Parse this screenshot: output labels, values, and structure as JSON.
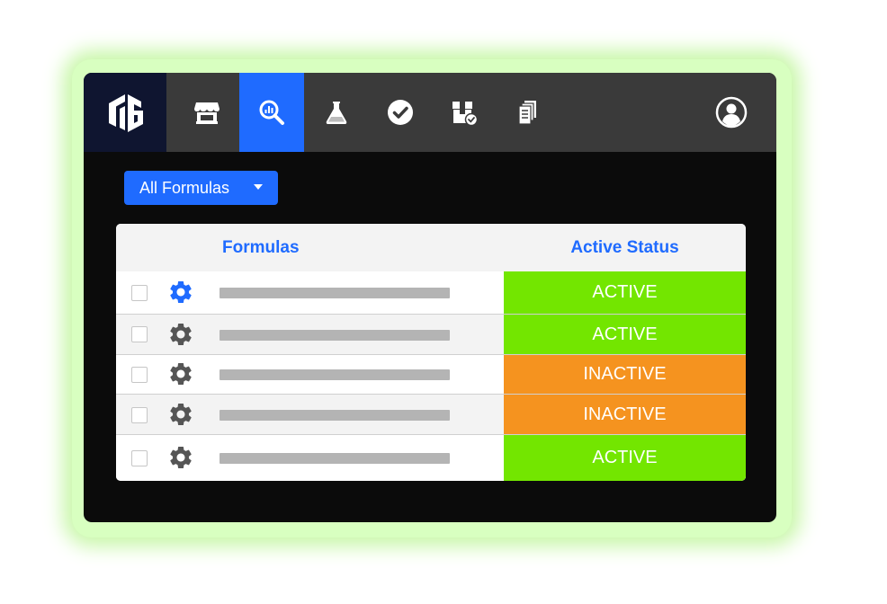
{
  "colors": {
    "accent": "#1f6bff",
    "active": "#73e600",
    "inactive": "#f5931f",
    "topbar": "#3a3a3a",
    "logo_bg": "#0f1530",
    "glow": "#c8f7a8"
  },
  "nav": {
    "logo_icon": "tg-logo-icon",
    "items": [
      {
        "icon": "storefront-icon",
        "active": false
      },
      {
        "icon": "search-analytics-icon",
        "active": true
      },
      {
        "icon": "flask-icon",
        "active": false
      },
      {
        "icon": "check-circle-icon",
        "active": false
      },
      {
        "icon": "package-check-icon",
        "active": false
      },
      {
        "icon": "documents-icon",
        "active": false
      }
    ],
    "account_icon": "user-circle-icon"
  },
  "filter": {
    "label": "All Formulas"
  },
  "table": {
    "headers": {
      "formulas": "Formulas",
      "status": "Active Status"
    },
    "rows": [
      {
        "status": "ACTIVE",
        "gear_highlighted": true
      },
      {
        "status": "ACTIVE",
        "gear_highlighted": false
      },
      {
        "status": "INACTIVE",
        "gear_highlighted": false
      },
      {
        "status": "INACTIVE",
        "gear_highlighted": false
      },
      {
        "status": "ACTIVE",
        "gear_highlighted": false
      }
    ]
  }
}
